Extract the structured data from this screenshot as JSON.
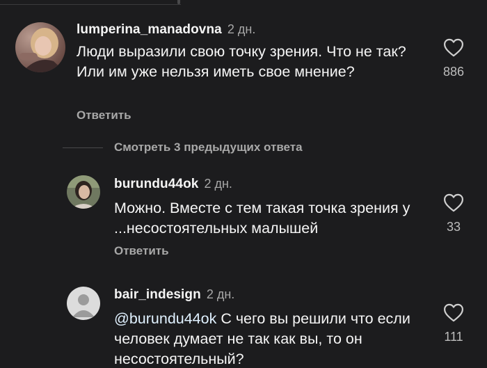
{
  "comments": [
    {
      "username": "lumperina_manadovna",
      "time": "2 дн.",
      "text": "Люди выразили свою точку зрения. Что не так? Или им уже нельзя иметь свое мнение?",
      "reply_label": "Ответить",
      "likes": "886",
      "avatar": "photo"
    },
    {
      "username": "burundu44ok",
      "time": "2 дн.",
      "text": "Можно. Вместе с тем такая точка зрения у ...несостоятельных малышей",
      "reply_label": "Ответить",
      "likes": "33",
      "avatar": "photo"
    },
    {
      "username": "bair_indesign",
      "time": "2 дн.",
      "mention": "@burundu44ok",
      "text": " С чего вы решили что если человек думает не так как вы, то он несостоятельный?",
      "likes": "111",
      "avatar": "default-user-icon"
    }
  ],
  "view_previous_replies": "Смотреть 3 предыдущих ответа",
  "icons": {
    "like": "heart-outline-icon",
    "default_avatar": "person-icon"
  },
  "colors": {
    "background": "#1c1c1e",
    "text": "#f5f5f5",
    "secondary": "#a8a8a8",
    "mention": "#e0f1ff"
  }
}
